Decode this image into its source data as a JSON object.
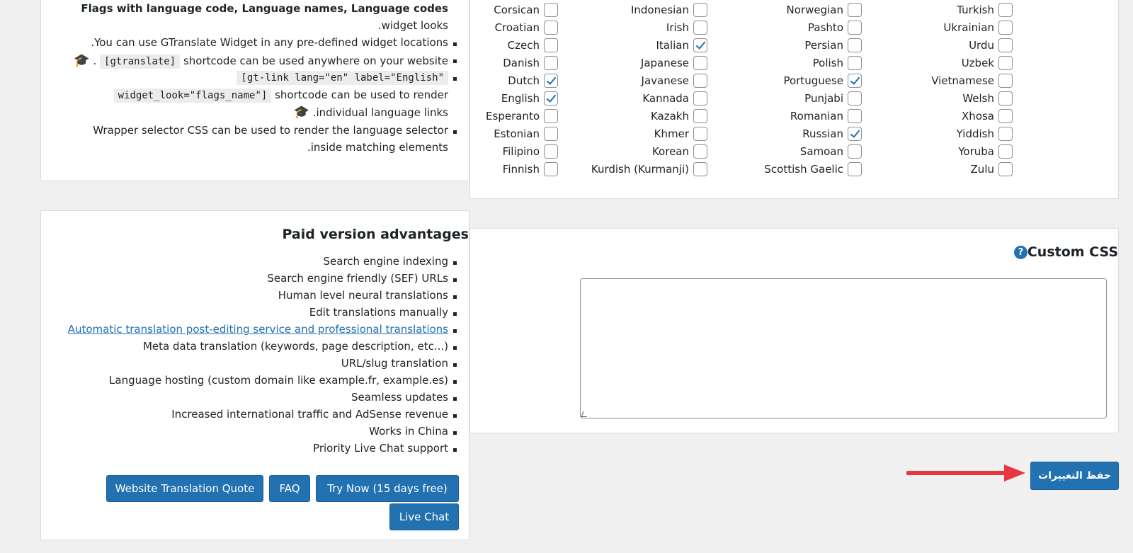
{
  "info": {
    "heading": "Flags with language code, Language names, Language codes",
    "widget_looks": ".widget looks",
    "predefined": ".You can use GTranslate Widget in any pre-defined widget locations",
    "shortcode_code": "[gtranslate]",
    "shortcode_text": "shortcode can be used anywhere on your website",
    "gtlink_code_1": "[gt-link lang=\"en\" label=\"English\"",
    "gtlink_code_2": "widget_look=\"flags_name\"]",
    "gtlink_text": "shortcode can be used to render",
    "individual": ".individual language links",
    "wrapper_1": "Wrapper selector CSS can be used to render the language selector",
    "wrapper_2": ".inside matching elements"
  },
  "languages": [
    {
      "name": "Corsican",
      "checked": false
    },
    {
      "name": "Croatian",
      "checked": false
    },
    {
      "name": "Czech",
      "checked": false
    },
    {
      "name": "Danish",
      "checked": false
    },
    {
      "name": "Dutch",
      "checked": true
    },
    {
      "name": "English",
      "checked": true
    },
    {
      "name": "Esperanto",
      "checked": false
    },
    {
      "name": "Estonian",
      "checked": false
    },
    {
      "name": "Filipino",
      "checked": false
    },
    {
      "name": "Finnish",
      "checked": false
    },
    {
      "name": "Indonesian",
      "checked": false
    },
    {
      "name": "Irish",
      "checked": false
    },
    {
      "name": "Italian",
      "checked": true
    },
    {
      "name": "Japanese",
      "checked": false
    },
    {
      "name": "Javanese",
      "checked": false
    },
    {
      "name": "Kannada",
      "checked": false
    },
    {
      "name": "Kazakh",
      "checked": false
    },
    {
      "name": "Khmer",
      "checked": false
    },
    {
      "name": "Korean",
      "checked": false
    },
    {
      "name": "Kurdish (Kurmanji)",
      "checked": false
    },
    {
      "name": "Norwegian",
      "checked": false
    },
    {
      "name": "Pashto",
      "checked": false
    },
    {
      "name": "Persian",
      "checked": false
    },
    {
      "name": "Polish",
      "checked": false
    },
    {
      "name": "Portuguese",
      "checked": true
    },
    {
      "name": "Punjabi",
      "checked": false
    },
    {
      "name": "Romanian",
      "checked": false
    },
    {
      "name": "Russian",
      "checked": true
    },
    {
      "name": "Samoan",
      "checked": false
    },
    {
      "name": "Scottish Gaelic",
      "checked": false
    },
    {
      "name": "Turkish",
      "checked": false
    },
    {
      "name": "Ukrainian",
      "checked": false
    },
    {
      "name": "Urdu",
      "checked": false
    },
    {
      "name": "Uzbek",
      "checked": false
    },
    {
      "name": "Vietnamese",
      "checked": false
    },
    {
      "name": "Welsh",
      "checked": false
    },
    {
      "name": "Xhosa",
      "checked": false
    },
    {
      "name": "Yiddish",
      "checked": false
    },
    {
      "name": "Yoruba",
      "checked": false
    },
    {
      "name": "Zulu",
      "checked": false
    }
  ],
  "paid": {
    "title": "Paid version advantages",
    "features": [
      {
        "text": "Search engine indexing",
        "link": false
      },
      {
        "text": "Search engine friendly (SEF) URLs",
        "link": false
      },
      {
        "text": "Human level neural translations",
        "link": false
      },
      {
        "text": "Edit translations manually",
        "link": false
      },
      {
        "text": "Automatic translation post-editing service and professional translations",
        "link": true
      },
      {
        "text": "Meta data translation (keywords, page description, etc...)",
        "link": false
      },
      {
        "text": "URL/slug translation",
        "link": false
      },
      {
        "text": "Language hosting (custom domain like example.fr, example.es)",
        "link": false
      },
      {
        "text": "Seamless updates",
        "link": false
      },
      {
        "text": "Increased international traffic and AdSense revenue",
        "link": false
      },
      {
        "text": "Works in China",
        "link": false
      },
      {
        "text": "Priority Live Chat support",
        "link": false
      }
    ],
    "buttons": {
      "quote": "Website Translation Quote",
      "faq": "FAQ",
      "try_now": "Try Now (15 days free)",
      "live_chat": "Live Chat"
    }
  },
  "custom_css": {
    "title": "Custom CSS",
    "help": "?",
    "value": ""
  },
  "save_button": "حفظ التغييرات",
  "colors": {
    "accent": "#2271b1",
    "arrow": "#e8383d",
    "background": "#f0f0f1"
  }
}
